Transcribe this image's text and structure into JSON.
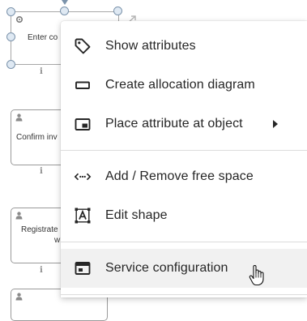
{
  "canvas": {
    "shapes": [
      {
        "id": "enter",
        "label": "Enter co"
      },
      {
        "id": "confirm",
        "label": "Confirm inv"
      },
      {
        "id": "registrate",
        "label_line1": "Registrate",
        "label_line2": "w"
      }
    ]
  },
  "context_menu": {
    "items": [
      {
        "id": "show-attributes",
        "label": "Show attributes",
        "icon": "tag-icon"
      },
      {
        "id": "create-allocation-diagram",
        "label": "Create allocation diagram",
        "icon": "rectangle-icon"
      },
      {
        "id": "place-attribute",
        "label": "Place attribute at object",
        "icon": "placement-icon",
        "has_submenu": true
      },
      {
        "id": "add-remove-free-space",
        "label": "Add / Remove free space",
        "icon": "free-space-icon"
      },
      {
        "id": "edit-shape",
        "label": "Edit shape",
        "icon": "edit-shape-icon"
      },
      {
        "id": "service-configuration",
        "label": "Service configuration",
        "icon": "service-config-icon",
        "hovered": true
      }
    ]
  },
  "colors": {
    "menu_text": "#262626",
    "hover_bg": "#f1f1f1",
    "divider": "#dcdcdc",
    "selection_handle": "#7b93ab"
  }
}
